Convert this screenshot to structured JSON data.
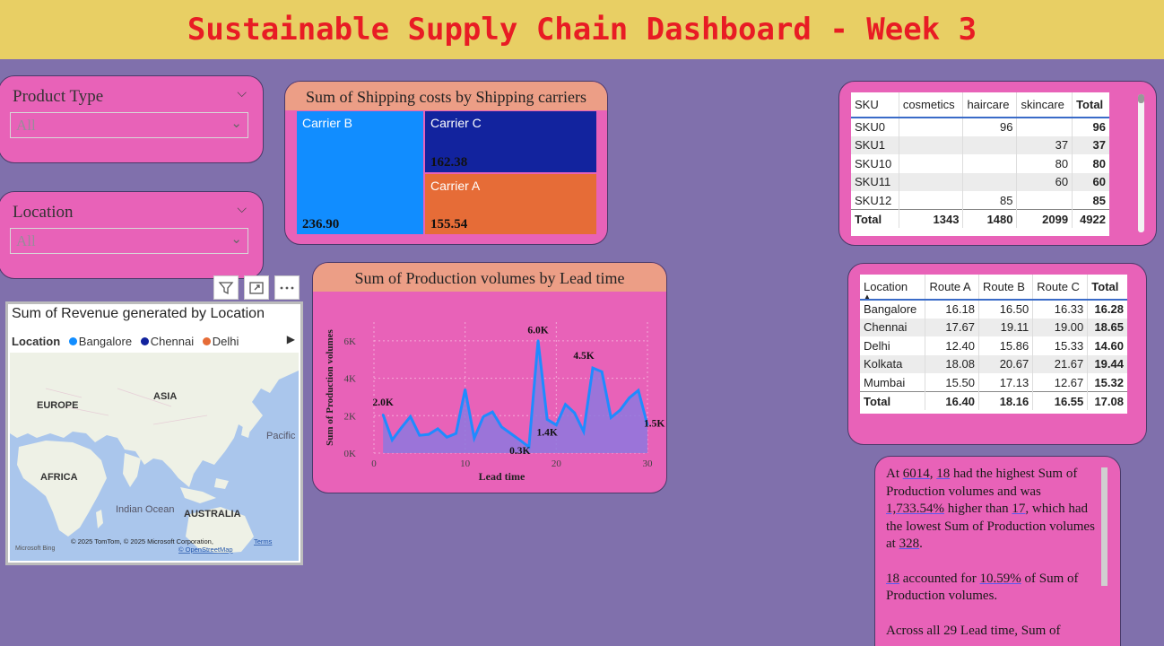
{
  "header": {
    "title": "Sustainable Supply Chain Dashboard - Week 3"
  },
  "slicers": [
    {
      "title": "Product Type",
      "value": "All"
    },
    {
      "title": "Location",
      "value": "All"
    }
  ],
  "treemap": {
    "title": "Sum of Shipping costs by Shipping carriers",
    "items": [
      {
        "label": "Carrier B",
        "value": "236.90",
        "color": "#118dff"
      },
      {
        "label": "Carrier C",
        "value": "162.38",
        "color": "#12239e"
      },
      {
        "label": "Carrier A",
        "value": "155.54",
        "color": "#e66c37"
      }
    ]
  },
  "matrix_sku": {
    "columns": [
      "SKU",
      "cosmetics",
      "haircare",
      "skincare",
      "Total"
    ],
    "rows": [
      [
        "SKU0",
        "",
        "96",
        "",
        "96"
      ],
      [
        "SKU1",
        "",
        "",
        "37",
        "37"
      ],
      [
        "SKU10",
        "",
        "",
        "80",
        "80"
      ],
      [
        "SKU11",
        "",
        "",
        "60",
        "60"
      ],
      [
        "SKU12",
        "",
        "85",
        "",
        "85"
      ]
    ],
    "total": [
      "Total",
      "1343",
      "1480",
      "2099",
      "4922"
    ]
  },
  "matrix_location": {
    "columns": [
      "Location",
      "Route A",
      "Route B",
      "Route C",
      "Total"
    ],
    "rows": [
      [
        "Bangalore",
        "16.18",
        "16.50",
        "16.33",
        "16.28"
      ],
      [
        "Chennai",
        "17.67",
        "19.11",
        "19.00",
        "18.65"
      ],
      [
        "Delhi",
        "12.40",
        "15.86",
        "15.33",
        "14.60"
      ],
      [
        "Kolkata",
        "18.08",
        "20.67",
        "21.67",
        "19.44"
      ],
      [
        "Mumbai",
        "15.50",
        "17.13",
        "12.67",
        "15.32"
      ]
    ],
    "total": [
      "Total",
      "16.40",
      "18.16",
      "16.55",
      "17.08"
    ]
  },
  "map": {
    "title": "Sum of Revenue generated by Location",
    "legend_title": "Location",
    "legend": [
      {
        "name": "Bangalore",
        "color": "#118dff"
      },
      {
        "name": "Chennai",
        "color": "#12239e"
      },
      {
        "name": "Delhi",
        "color": "#e66c37"
      }
    ],
    "labels": [
      "EUROPE",
      "ASIA",
      "AFRICA",
      "Indian Ocean",
      "AUSTRALIA",
      "Pacific Ocean"
    ],
    "copyright": "© 2025 TomTom, © 2025 Microsoft Corporation,",
    "terms": "Terms",
    "osm": "© OpenStreetMap",
    "bing": "Microsoft Bing"
  },
  "chart_data": {
    "type": "area",
    "title": "Sum of Production volumes by Lead time",
    "xlabel": "Lead time",
    "ylabel": "Sum of Production volumes",
    "xlim": [
      0,
      30
    ],
    "ylim": [
      0,
      7000
    ],
    "yticks": [
      "0K",
      "2K",
      "4K",
      "6K"
    ],
    "xticks": [
      "0",
      "10",
      "20",
      "30"
    ],
    "x": [
      1,
      2,
      3,
      4,
      5,
      6,
      7,
      8,
      9,
      10,
      11,
      12,
      13,
      14,
      15,
      16,
      17,
      18,
      19,
      20,
      21,
      22,
      23,
      24,
      25,
      26,
      27,
      28,
      29,
      30
    ],
    "values": [
      2050,
      700,
      1350,
      1950,
      950,
      1000,
      1300,
      850,
      1050,
      3400,
      800,
      1950,
      2200,
      1400,
      1050,
      700,
      328,
      6014,
      1800,
      1500,
      2600,
      2150,
      1150,
      4550,
      4350,
      1900,
      2300,
      2950,
      3350,
      1500
    ],
    "data_labels": [
      {
        "x": 1,
        "text": "2.0K"
      },
      {
        "x": 17,
        "text": "0.3K"
      },
      {
        "x": 18,
        "text": "6.0K"
      },
      {
        "x": 19,
        "text": "1.4K"
      },
      {
        "x": 24,
        "text": "4.5K"
      },
      {
        "x": 30,
        "text": "1.5K"
      }
    ]
  },
  "narrative": {
    "p1_a": "At ",
    "p1_b": "6014",
    "p1_c": ", ",
    "p1_d": "18",
    "p1_e": " had the highest Sum of Production volumes and was ",
    "p1_f": "1,733.54%",
    "p1_g": " higher than ",
    "p1_h": "17",
    "p1_i": ", which had the lowest Sum of Production volumes at ",
    "p1_j": "328",
    "p1_k": ".",
    "p2_a": "18",
    "p2_b": " accounted for ",
    "p2_c": "10.59%",
    "p2_d": " of Sum of Production volumes.",
    "p3": "Across all 29 Lead time, Sum of"
  },
  "toolbar": {
    "filter": "filter-icon",
    "focus": "focus-mode-icon",
    "more": "more-options-icon"
  }
}
